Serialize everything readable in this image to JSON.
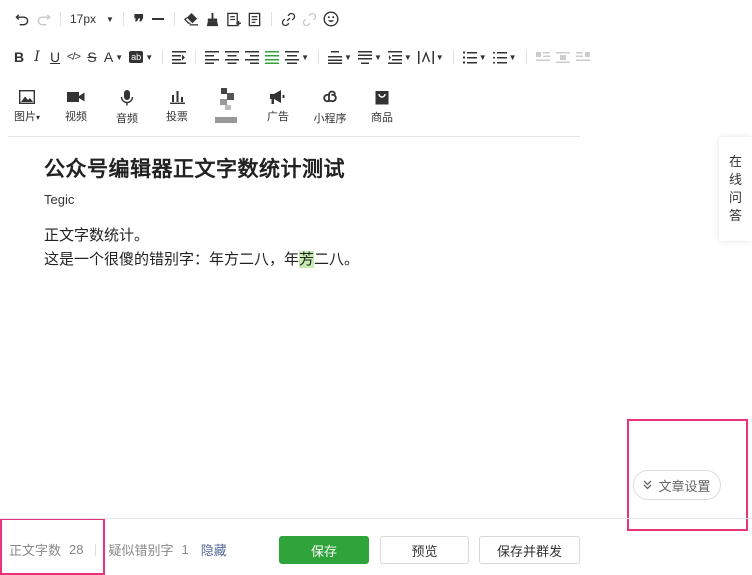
{
  "toolbar": {
    "font_size": "17px"
  },
  "insert_bar": {
    "items": [
      {
        "label": "图片",
        "icon": "image-icon"
      },
      {
        "label": "视频",
        "icon": "video-icon"
      },
      {
        "label": "音频",
        "icon": "microphone-icon"
      },
      {
        "label": "投票",
        "icon": "poll-icon"
      },
      {
        "label": "",
        "icon": "mosaic-placeholder-icon"
      },
      {
        "label": "广告",
        "icon": "megaphone-icon"
      },
      {
        "label": "小程序",
        "icon": "mini-program-icon"
      },
      {
        "label": "商品",
        "icon": "shopping-bag-icon"
      }
    ]
  },
  "document": {
    "title": "公众号编辑器正文字数统计测试",
    "author": "Tegic",
    "line1": "正文字数统计。",
    "line2_before": "这是一个很傻的错别字：年方二八，年",
    "line2_highlight": "芳",
    "line2_after": "二八。"
  },
  "side_help": {
    "chars": [
      "在",
      "线",
      "问",
      "答"
    ]
  },
  "article_settings": {
    "label": "文章设置"
  },
  "footer": {
    "word_count_label": "正文字数",
    "word_count_value": "28",
    "typo_label": "疑似错别字",
    "typo_count": "1",
    "hide_link": "隐藏",
    "save": "保存",
    "preview": "预览",
    "save_and_send": "保存并群发"
  },
  "colors": {
    "primary_green": "#2fa43a",
    "highlight_green": "#c5ebb1",
    "annotation_pink": "#e8337a",
    "link_blue": "#576b95"
  }
}
